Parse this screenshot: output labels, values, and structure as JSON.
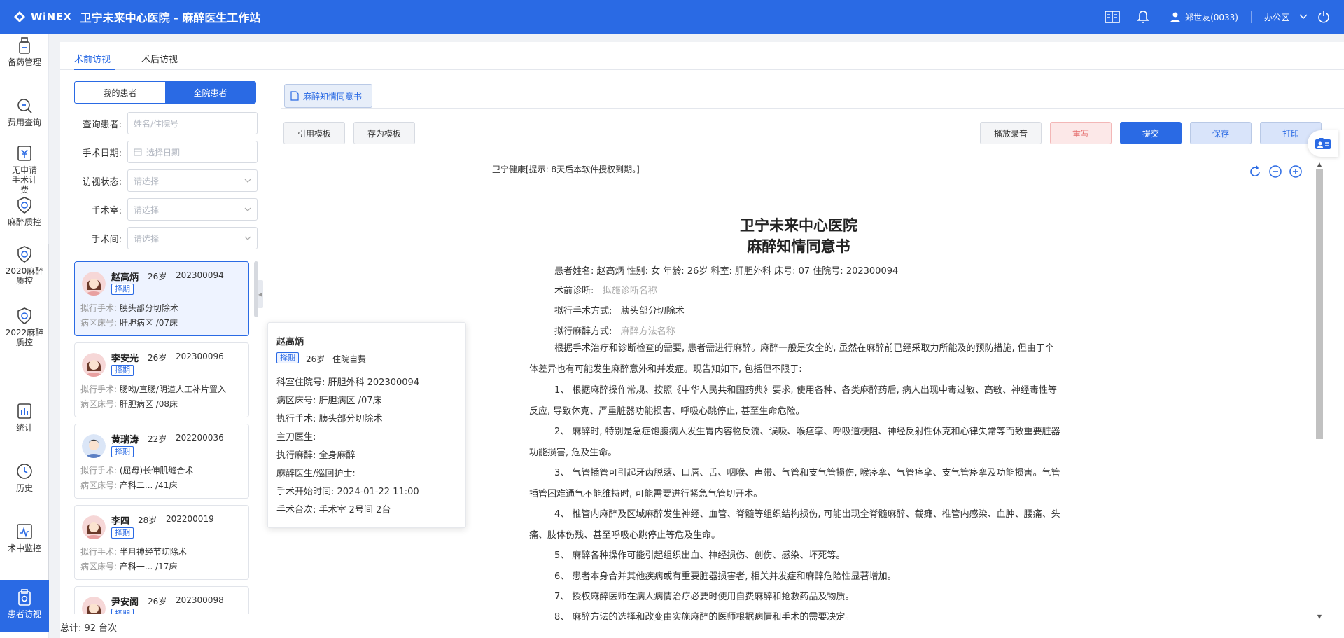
{
  "topbar": {
    "brand": "WiNEX",
    "title": "卫宁未来中心医院 - 麻醉医生工作站",
    "user": "郑世友(0033)",
    "office": "办公区"
  },
  "nav": [
    {
      "label": "备药管理",
      "icon": "medicine-icon"
    },
    {
      "label": "费用查询",
      "icon": "fee-query-icon"
    },
    {
      "label": "无申请手术计费",
      "icon": "yen-icon"
    },
    {
      "label": "麻醉质控",
      "icon": "shield-check-icon"
    },
    {
      "label": "2020麻醉质控",
      "icon": "shield-check-icon"
    },
    {
      "label": "2022麻醉质控",
      "icon": "shield-check-icon"
    },
    {
      "label": "统计",
      "icon": "bar-chart-icon"
    },
    {
      "label": "历史",
      "icon": "clock-icon"
    },
    {
      "label": "术中监控",
      "icon": "monitor-icon"
    },
    {
      "label": "患者访视",
      "icon": "visit-icon"
    }
  ],
  "tabs": [
    "术前访视",
    "术后访视"
  ],
  "segment": {
    "mine": "我的患者",
    "all": "全院患者"
  },
  "filters": {
    "query_label": "查询患者:",
    "query_placeholder": "姓名/住院号",
    "date_label": "手术日期:",
    "date_placeholder": "选择日期",
    "status_label": "访视状态:",
    "status_placeholder": "请选择",
    "room_label": "手术室:",
    "room_placeholder": "请选择",
    "theater_label": "手术间:",
    "theater_placeholder": "请选择"
  },
  "list_labels": {
    "surgery": "拟行手术:",
    "bed": "病区床号:"
  },
  "patients": [
    {
      "name": "赵高炳",
      "age": "26岁",
      "id": "202300094",
      "badge": "择期",
      "surgery": "胰头部分切除术",
      "bed": "肝胆病区 /07床",
      "gender": "female"
    },
    {
      "name": "李安光",
      "age": "26岁",
      "id": "202300096",
      "badge": "择期",
      "surgery": "肠吻/直肠/阴道人工补片置入",
      "bed": "肝胆病区 /08床",
      "gender": "female"
    },
    {
      "name": "黄瑞涛",
      "age": "22岁",
      "id": "202200036",
      "badge": "择期",
      "surgery": "(屈母)长伸肌缝合术",
      "bed": "产科二...    /41床",
      "gender": "male"
    },
    {
      "name": "李四",
      "age": "28岁",
      "id": "202200019",
      "badge": "择期",
      "surgery": "半月神经节切除术",
      "bed": "产科一...    /17床",
      "gender": "female"
    },
    {
      "name": "尹安阁",
      "age": "26岁",
      "id": "202300098",
      "badge": "择期",
      "surgery": "",
      "bed": "",
      "gender": "female"
    }
  ],
  "total": "总计:  92 台次",
  "popover": {
    "name": "赵高炳",
    "badge": "择期",
    "age": "26岁",
    "pay": "住院自费",
    "rows": [
      "科室住院号: 肝胆外科 202300094",
      "病区床号: 肝胆病区 /07床",
      "执行手术: 胰头部分切除术",
      "主刀医生:",
      "执行麻醉: 全身麻醉",
      "麻醉医生/巡回护士:",
      "手术开始时间: 2024-01-22 11:00",
      "手术台次: 手术室 2号间 2台"
    ]
  },
  "doc_tab": "麻醉知情同意书",
  "toolbar": {
    "cite": "引用模板",
    "save_tpl": "存为模板",
    "play": "播放录音",
    "rewrite": "重写",
    "submit": "提交",
    "save": "保存",
    "print": "打印"
  },
  "document": {
    "license": "卫宁健康[提示: 8天后本软件授权到期。]",
    "hospital": "卫宁未来中心医院",
    "title": "麻醉知情同意书",
    "info_line": "患者姓名: 赵高炳   性别: 女   年龄: 26岁   科室: 肝胆外科   床号: 07  住院号: 202300094",
    "diag_label": "术前诊断:",
    "diag_ph": "拟施诊断名称",
    "surgery_label": "拟行手术方式:",
    "surgery_val": "胰头部分切除术",
    "anes_label": "拟行麻醉方式:",
    "anes_ph": "麻醉方法名称",
    "paragraphs": [
      "根据手术治疗和诊断检查的需要, 患者需进行麻醉。麻醉一般是安全的, 虽然在麻醉前已经采取力所能及的预防措施, 但由于个体差异也有可能发生麻醉意外和并发症。现告知如下, 包括但不限于:",
      "1、 根据麻醉操作常规、按照《中华人民共和国药典》要求, 使用各种、各类麻醉药后, 病人出现中毒过敏、高敏、神经毒性等反应, 导致休克、严重脏器功能损害、呼吸心跳停止, 甚至生命危险。",
      "2、 麻醉时, 特别是急症饱腹病人发生胃内容物反流、误吸、喉痉挛、呼吸道梗阻、神经反射性休克和心律失常等而致重要脏器功能损害, 危及生命。",
      "3、 气管插管可引起牙齿脱落、口唇、舌、咽喉、声带、气管和支气管损伤, 喉痉挛、气管痉挛、支气管痉挛及功能损害。气管插管困难通气不能维持时, 可能需要进行紧急气管切开术。",
      "4、 椎管内麻醉及区域麻醉发生神经、血管、脊髓等组织结构损伤, 可能出现全脊髓麻醉、截瘫、椎管内感染、血肿、腰痛、头痛、肢体伤残、甚至呼吸心跳停止等危及生命。",
      "5、 麻醉各种操作可能引起组织出血、神经损伤、创伤、感染、坏死等。",
      "6、 患者本身合并其他疾病或有重要脏器损害者, 相关并发症和麻醉危险性显著增加。",
      "7、 授权麻醉医师在病人病情治疗必要时使用自费麻醉和抢救药品及物质。",
      "8、 麻醉方法的选择和改变由实施麻醉的医师根据病情和手术的需要决定。"
    ]
  }
}
